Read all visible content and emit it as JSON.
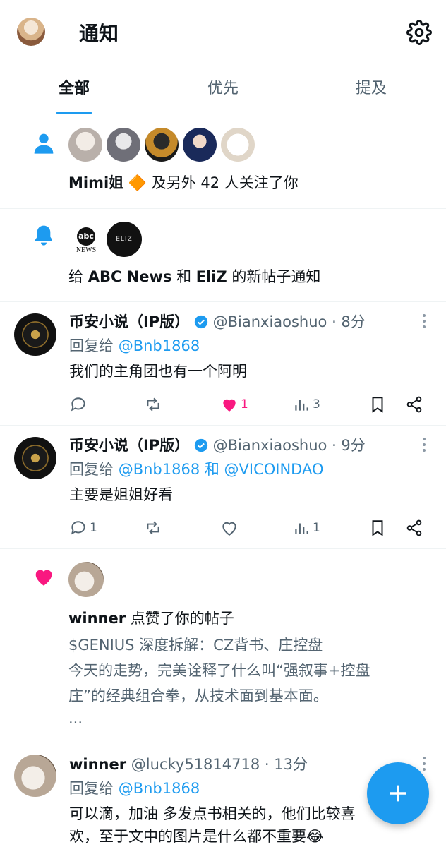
{
  "header": {
    "title": "通知"
  },
  "tabs": [
    {
      "label": "全部",
      "active": true
    },
    {
      "label": "优先"
    },
    {
      "label": "提及"
    }
  ],
  "follow_notification": {
    "name": "Mimi姐",
    "emoji": "🔶",
    "text": "及另外 42 人关注了你"
  },
  "bell_notification": {
    "prefix": "给 ",
    "source1": "ABC News",
    "middle": " 和 ",
    "source2": "EliZ",
    "suffix": " 的新帖子通知",
    "abc_logo_top": "abc",
    "abc_logo_bottom": "NEWS",
    "eliz_logo": "ELIZ"
  },
  "posts": [
    {
      "name": "币安小说（IP版）",
      "handle": "@Bianxiaoshuo · 8分",
      "reply_prefix": "回复给 ",
      "reply_to": "@Bnb1868",
      "text": "我们的主角团也有一个阿明",
      "replies": "",
      "likes": "1",
      "views": "3",
      "liked": true
    },
    {
      "name": "币安小说（IP版）",
      "handle": "@Bianxiaoshuo · 9分",
      "reply_prefix": "回复给 ",
      "reply_to": "@Bnb1868 和 @VICOINDAO",
      "text": "主要是姐姐好看",
      "replies": "1",
      "likes": "",
      "views": "1",
      "liked": false
    }
  ],
  "like_notification": {
    "name": "winner",
    "action": " 点赞了你的帖子",
    "line1": "$GENIUS 深度拆解：CZ背书、庄控盘",
    "line2": " 今天的走势，完美诠释了什么叫“强叙事+控盘",
    "line3": "庄”的经典组合拳，从技术面到基本面。",
    "line4": "..."
  },
  "last_post": {
    "name": "winner",
    "handle": "@lucky51814718 · 13分",
    "reply_prefix": "回复给 ",
    "reply_to": "@Bnb1868",
    "line1": "可以滴，加油  多发点书相关的，他们比较喜",
    "line2": "欢，至于文中的图片是什么都不重要😂"
  },
  "colors": {
    "accent": "#1d9bf0",
    "like": "#f91880",
    "text": "#0f1419",
    "secondary": "#536471"
  }
}
